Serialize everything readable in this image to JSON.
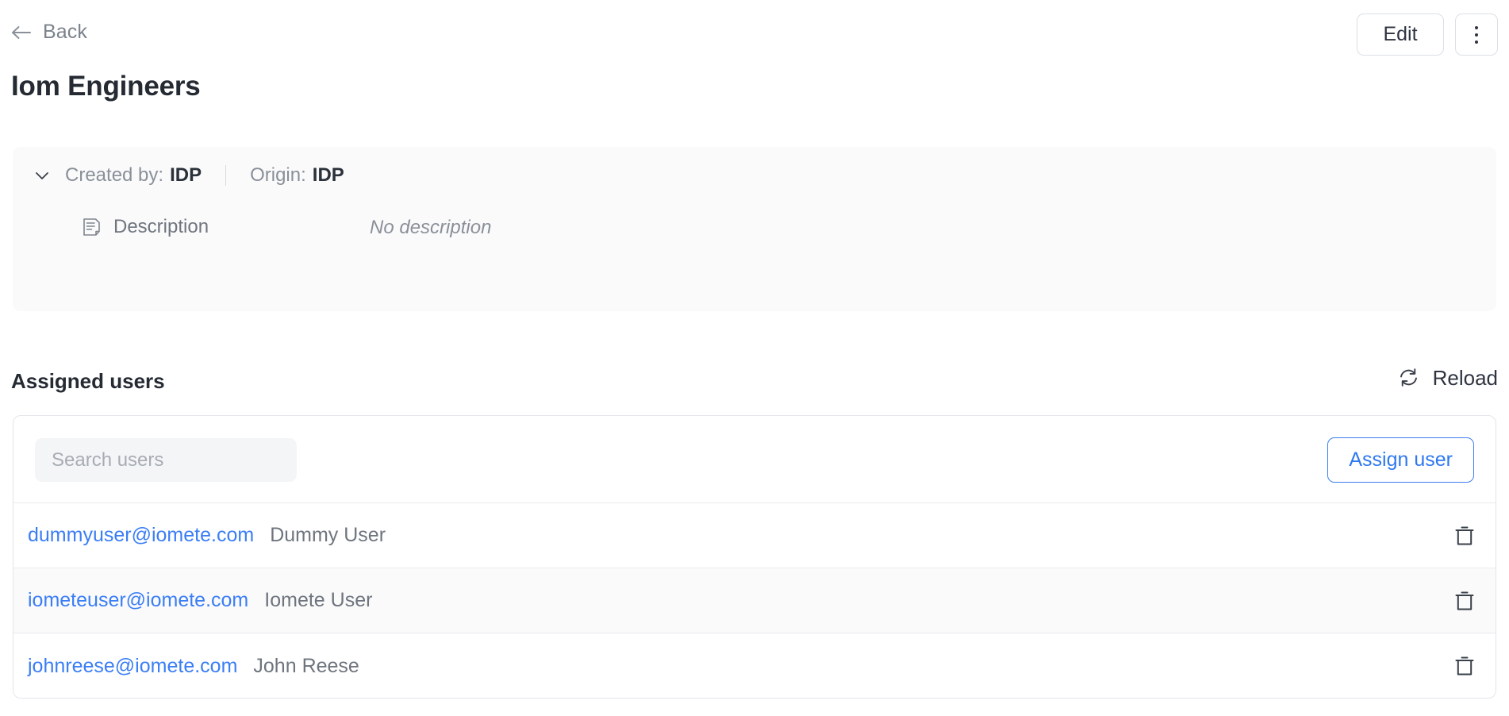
{
  "topbar": {
    "back_label": "Back",
    "back_icon": "arrow-left-icon",
    "edit_label": "Edit",
    "more_icon": "more-vertical-icon"
  },
  "page": {
    "title": "Iom Engineers"
  },
  "info_panel": {
    "collapse_icon": "chevron-down-icon",
    "created_by_label": "Created by:",
    "created_by_value": "IDP",
    "origin_label": "Origin:",
    "origin_value": "IDP",
    "description_icon": "document-text-icon",
    "description_label": "Description",
    "description_value": "No description"
  },
  "assigned_users": {
    "section_title": "Assigned users",
    "reload_label": "Reload",
    "reload_icon": "refresh-icon",
    "search_placeholder": "Search users",
    "search_value": "",
    "assign_label": "Assign user",
    "delete_icon": "trash-icon",
    "rows": [
      {
        "email": "dummyuser@iomete.com",
        "name": "Dummy User"
      },
      {
        "email": "iometeuser@iomete.com",
        "name": "Iomete User"
      },
      {
        "email": "johnreese@iomete.com",
        "name": "John Reese"
      }
    ]
  },
  "colors": {
    "link_blue": "#3b7ef5",
    "accent_blue": "#2f78f0",
    "text_dark": "#252a33",
    "text_muted": "#6f757e",
    "panel_bg": "#fafafb",
    "border": "#e3e5ea"
  }
}
